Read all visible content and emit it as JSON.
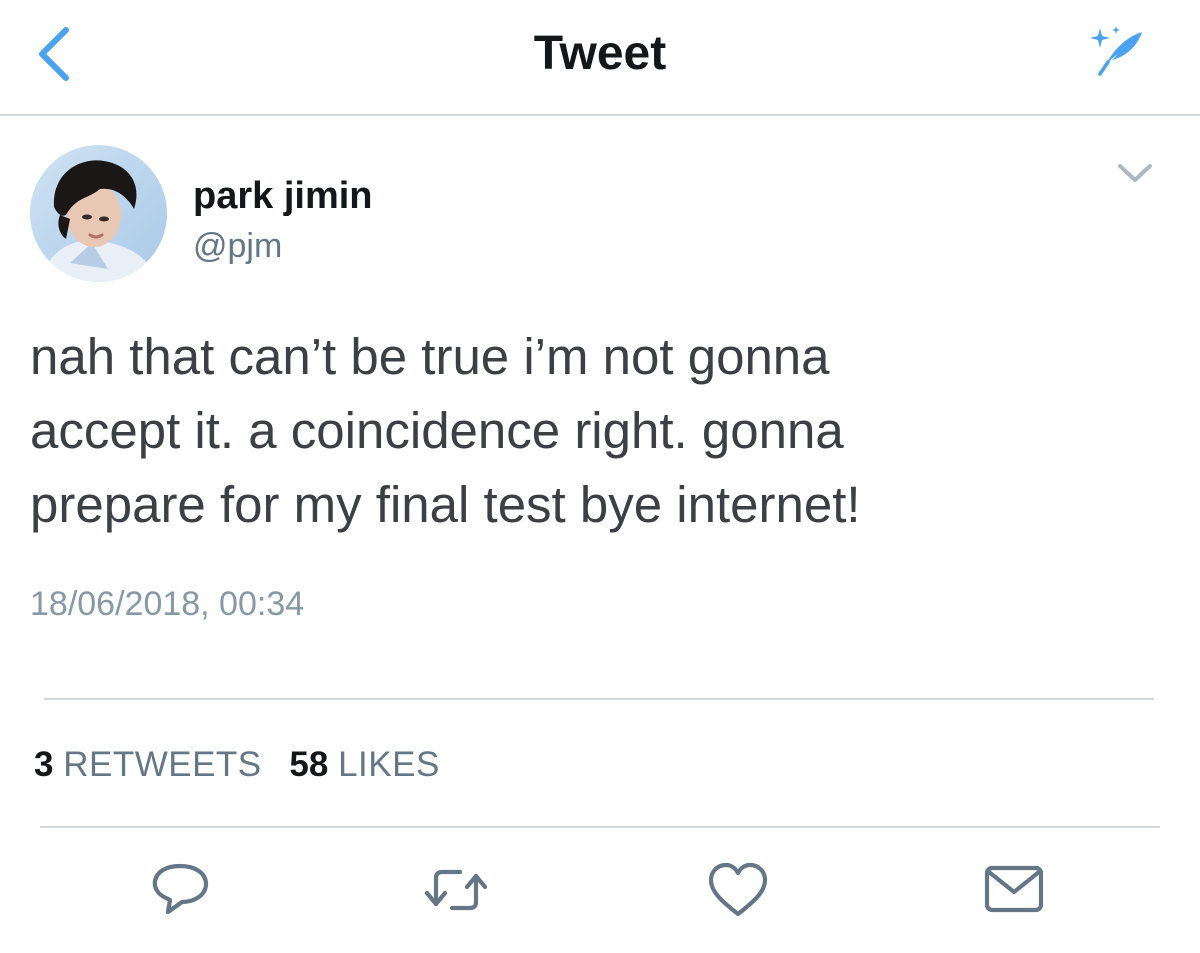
{
  "nav": {
    "title": "Tweet",
    "back_icon": "chevron-left-icon",
    "compose_icon": "sparkle-quill-icon",
    "accent_color": "#4aa3f0"
  },
  "tweet": {
    "author": {
      "name": "park jimin",
      "handle": "@pjm",
      "avatar": "profile-photo"
    },
    "lines": [
      "nah that can’t be true i’m not gonna",
      "accept it. a coincidence right. gonna",
      "prepare for my final test bye internet!"
    ],
    "timestamp": "18/06/2018, 00:34",
    "stats": {
      "retweets_count": "3",
      "retweets_label": "RETWEETS",
      "likes_count": "58",
      "likes_label": "LIKES"
    },
    "actions": [
      "reply-icon",
      "retweet-icon",
      "like-icon",
      "share-icon"
    ]
  }
}
